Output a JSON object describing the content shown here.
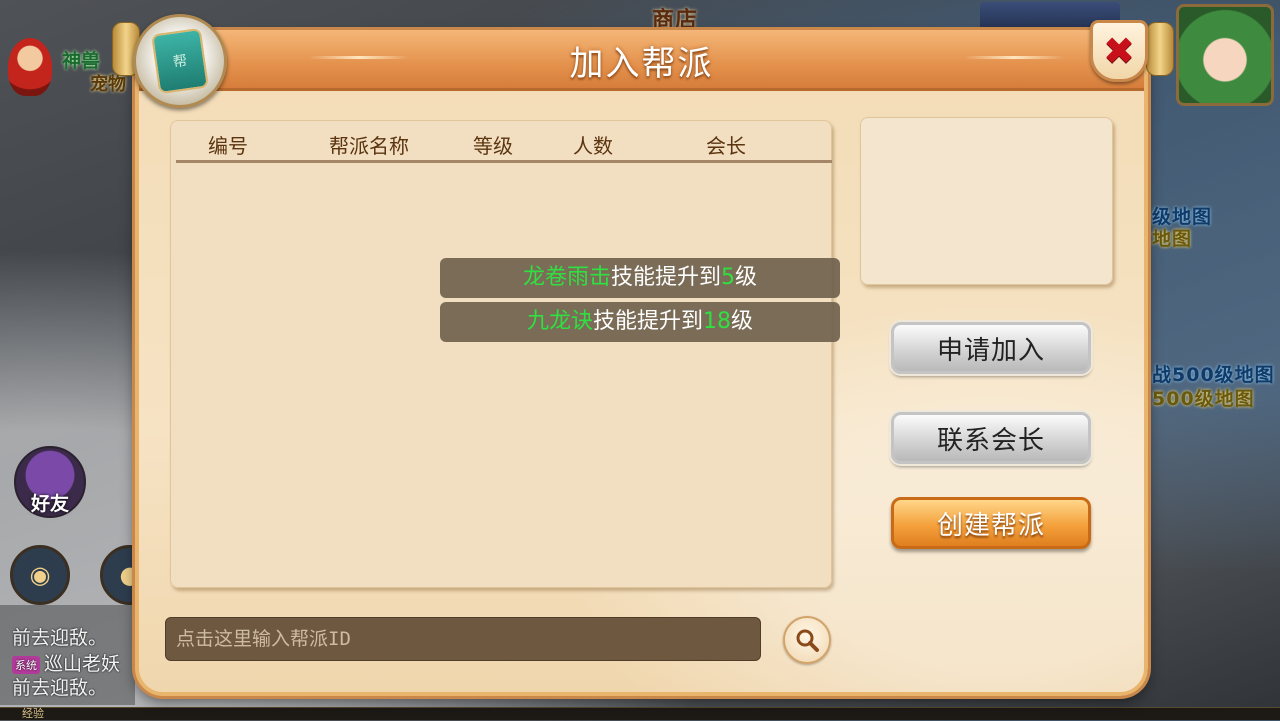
{
  "background": {
    "shop_label": "商店",
    "mascot_label_1": "神兽",
    "mascot_label_2": "宠物",
    "friend_label": "好友",
    "map_labels": [
      "级地图",
      "地图",
      "战500级地图",
      "500级地图"
    ],
    "chat_lines": [
      {
        "text": "前去迎敌。"
      },
      {
        "tag": "系统",
        "text": "巡山老妖"
      },
      {
        "text": "前去迎敌。"
      }
    ],
    "exp_label": "经验"
  },
  "dialog": {
    "title": "加入帮派",
    "emblem_char": "帮",
    "close_icon": "close-icon",
    "table": {
      "columns": [
        "编号",
        "帮派名称",
        "等级",
        "人数",
        "会长"
      ],
      "rows": []
    },
    "notifications": [
      {
        "skill": "龙卷雨击",
        "middle": "技能提升到",
        "level": "5",
        "suffix": "级"
      },
      {
        "skill": "九龙诀",
        "middle": "技能提升到",
        "level": "18",
        "suffix": "级"
      }
    ],
    "buttons": {
      "apply": "申请加入",
      "contact": "联系会长",
      "create": "创建帮派"
    },
    "search": {
      "placeholder": "点击这里输入帮派ID",
      "value": "",
      "icon": "search-icon"
    }
  },
  "colors": {
    "highlight_green": "#2fe040",
    "dialog_border": "#e9b46c",
    "title_bar": "#e4924d"
  }
}
